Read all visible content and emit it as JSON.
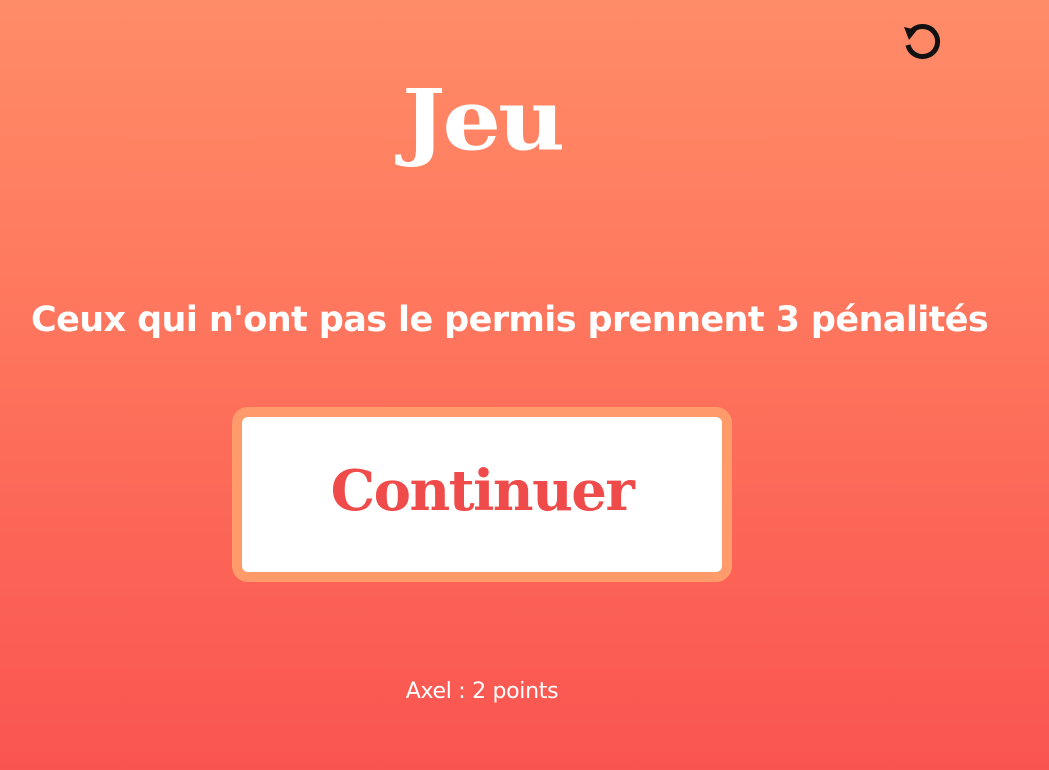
{
  "header": {
    "title": "Jeu",
    "reset_icon": "rotate-ccw-icon"
  },
  "game": {
    "prompt": "Ceux qui n'ont pas le permis prennent 3 pénalités",
    "continue_label": "Continuer",
    "score_line": "Axel : 2 points"
  },
  "colors": {
    "background_top": "#ff8c68",
    "background_bottom": "#fa5451",
    "button_border": "#ff9a6a",
    "button_text": "#f04b4b",
    "text": "#ffffff"
  }
}
